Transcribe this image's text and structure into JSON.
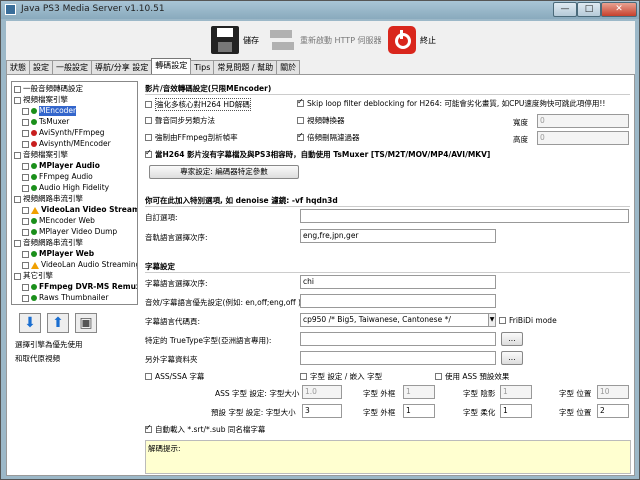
{
  "window": {
    "title": "Java PS3 Media Server v1.10.51",
    "min": "—",
    "max": "□",
    "close": "✕"
  },
  "toolbar": {
    "save": "儲存",
    "restart": "重新啟動 HTTP 伺服器",
    "quit": "終止"
  },
  "tabs": [
    "狀態",
    "設定",
    "一般設定",
    "導航/分享 設定",
    "轉碼設定",
    "Tips",
    "常見問題 / 幫助",
    "關於"
  ],
  "tree": [
    {
      "label": "一般音頻轉碼設定",
      "indent": 0,
      "kind": "none"
    },
    {
      "label": "視頻檔案引擎",
      "indent": 0,
      "kind": "none"
    },
    {
      "label": "MEncoder",
      "indent": 1,
      "kind": "g",
      "bold": false,
      "sel": true
    },
    {
      "label": "TsMuxer",
      "indent": 1,
      "kind": "g"
    },
    {
      "label": "AviSynth/FFmpeg",
      "indent": 1,
      "kind": "r"
    },
    {
      "label": "Avisynth/MEncoder",
      "indent": 1,
      "kind": "r"
    },
    {
      "label": "音頻檔案引擎",
      "indent": 0,
      "kind": "none"
    },
    {
      "label": "MPlayer Audio",
      "indent": 1,
      "kind": "g",
      "bold": true
    },
    {
      "label": "FFmpeg Audio",
      "indent": 1,
      "kind": "g"
    },
    {
      "label": "Audio High Fidelity",
      "indent": 1,
      "kind": "g"
    },
    {
      "label": "視頻網路串流引擎",
      "indent": 0,
      "kind": "none"
    },
    {
      "label": "VideoLan Video Streaming",
      "indent": 1,
      "kind": "w",
      "bold": true
    },
    {
      "label": "MEncoder Web",
      "indent": 1,
      "kind": "g"
    },
    {
      "label": "MPlayer Video Dump",
      "indent": 1,
      "kind": "g"
    },
    {
      "label": "音頻網路串流引擎",
      "indent": 0,
      "kind": "none"
    },
    {
      "label": "MPlayer Web",
      "indent": 1,
      "kind": "g",
      "bold": true
    },
    {
      "label": "VideoLan Audio Streaming",
      "indent": 1,
      "kind": "w"
    },
    {
      "label": "其它引擎",
      "indent": 0,
      "kind": "none"
    },
    {
      "label": "FFmpeg DVR-MS Remux",
      "indent": 1,
      "kind": "g",
      "bold": true
    },
    {
      "label": "Raws Thumbnailer",
      "indent": 1,
      "kind": "g"
    }
  ],
  "tree_notes": [
    "選擇引擎為優先使用",
    "和取代原視頻"
  ],
  "sec_general": "影片/音效轉碼設定(只限MEncoder)",
  "opt_multicore": "強化多核心對H264 HD解碼",
  "opt_skiploop": "Skip loop filter deblocking for H264: 可能會劣化畫質, 如CPU速度夠快可跳此項停用!!",
  "opt_av_sync": "聲音同步另類方法",
  "opt_scaler": "視頻轉換器",
  "width_label": "寬度",
  "width_val": "0",
  "opt_force_ffmpeg": "強制由FFmpeg剖析幀率",
  "opt_dbl_rate": "倍頻刪隔濾過器",
  "height_label": "高度",
  "height_val": "0",
  "opt_tsmuxer": "當H264 影片沒有字幕檔及與PS3相容時，自動使用 TsMuxer [TS/M2T/MOV/MP4/AVI/MKV]",
  "codec_btn": "專家設定: 編碼器特定參數",
  "sec_custom": "你可在此加入特別選項, 如 denoise 濾鏡: -vf hqdn3d",
  "custom_label": "自訂選項:",
  "custom_val": "",
  "audiolang_label": "音軌語言選擇次序:",
  "audiolang_val": "eng,fre,jpn,ger",
  "sec_subs": "字幕設定",
  "sublang_label": "字幕語言選擇次序:",
  "sublang_val": "chi",
  "pair_label": "音效/字幕語言優先設定(例如: en,off;eng,off ):",
  "pair_val": "",
  "subcode_label": "字幕語言代碼頁:",
  "subcode_val": "cp950   /* Big5, Taiwanese, Cantonese */",
  "fribidi": "FriBiDi mode",
  "font_label": "特定的 TrueType字型(亞洲語言專用):",
  "font_val": "",
  "browse": "...",
  "altsubs_label": "另外字幕資料夾",
  "altsubs_val": "",
  "ass": "ASS/SSA 字幕",
  "sub_style": "字型 設定 / 嵌入 字型",
  "ass_default": "使用 ASS 預設效果",
  "ass_row_label": "ASS 字型 設定: 字型大小",
  "ass_size": "1.0",
  "outline_label": "字型 外框",
  "ass_outline": "1",
  "shadow_label": "字型 陰影",
  "ass_shadow": "1",
  "pos_label": "字型 位置",
  "ass_pos": "10",
  "def_row_label": "預設 字型 設定: 字型大小",
  "def_size": "3",
  "def_outline": "1",
  "blur_label": "字型 柔化",
  "def_blur": "1",
  "def_pos": "2",
  "autoload": "自動載入 *.srt/*.sub 同名檔字幕",
  "hint": "解碼提示:"
}
